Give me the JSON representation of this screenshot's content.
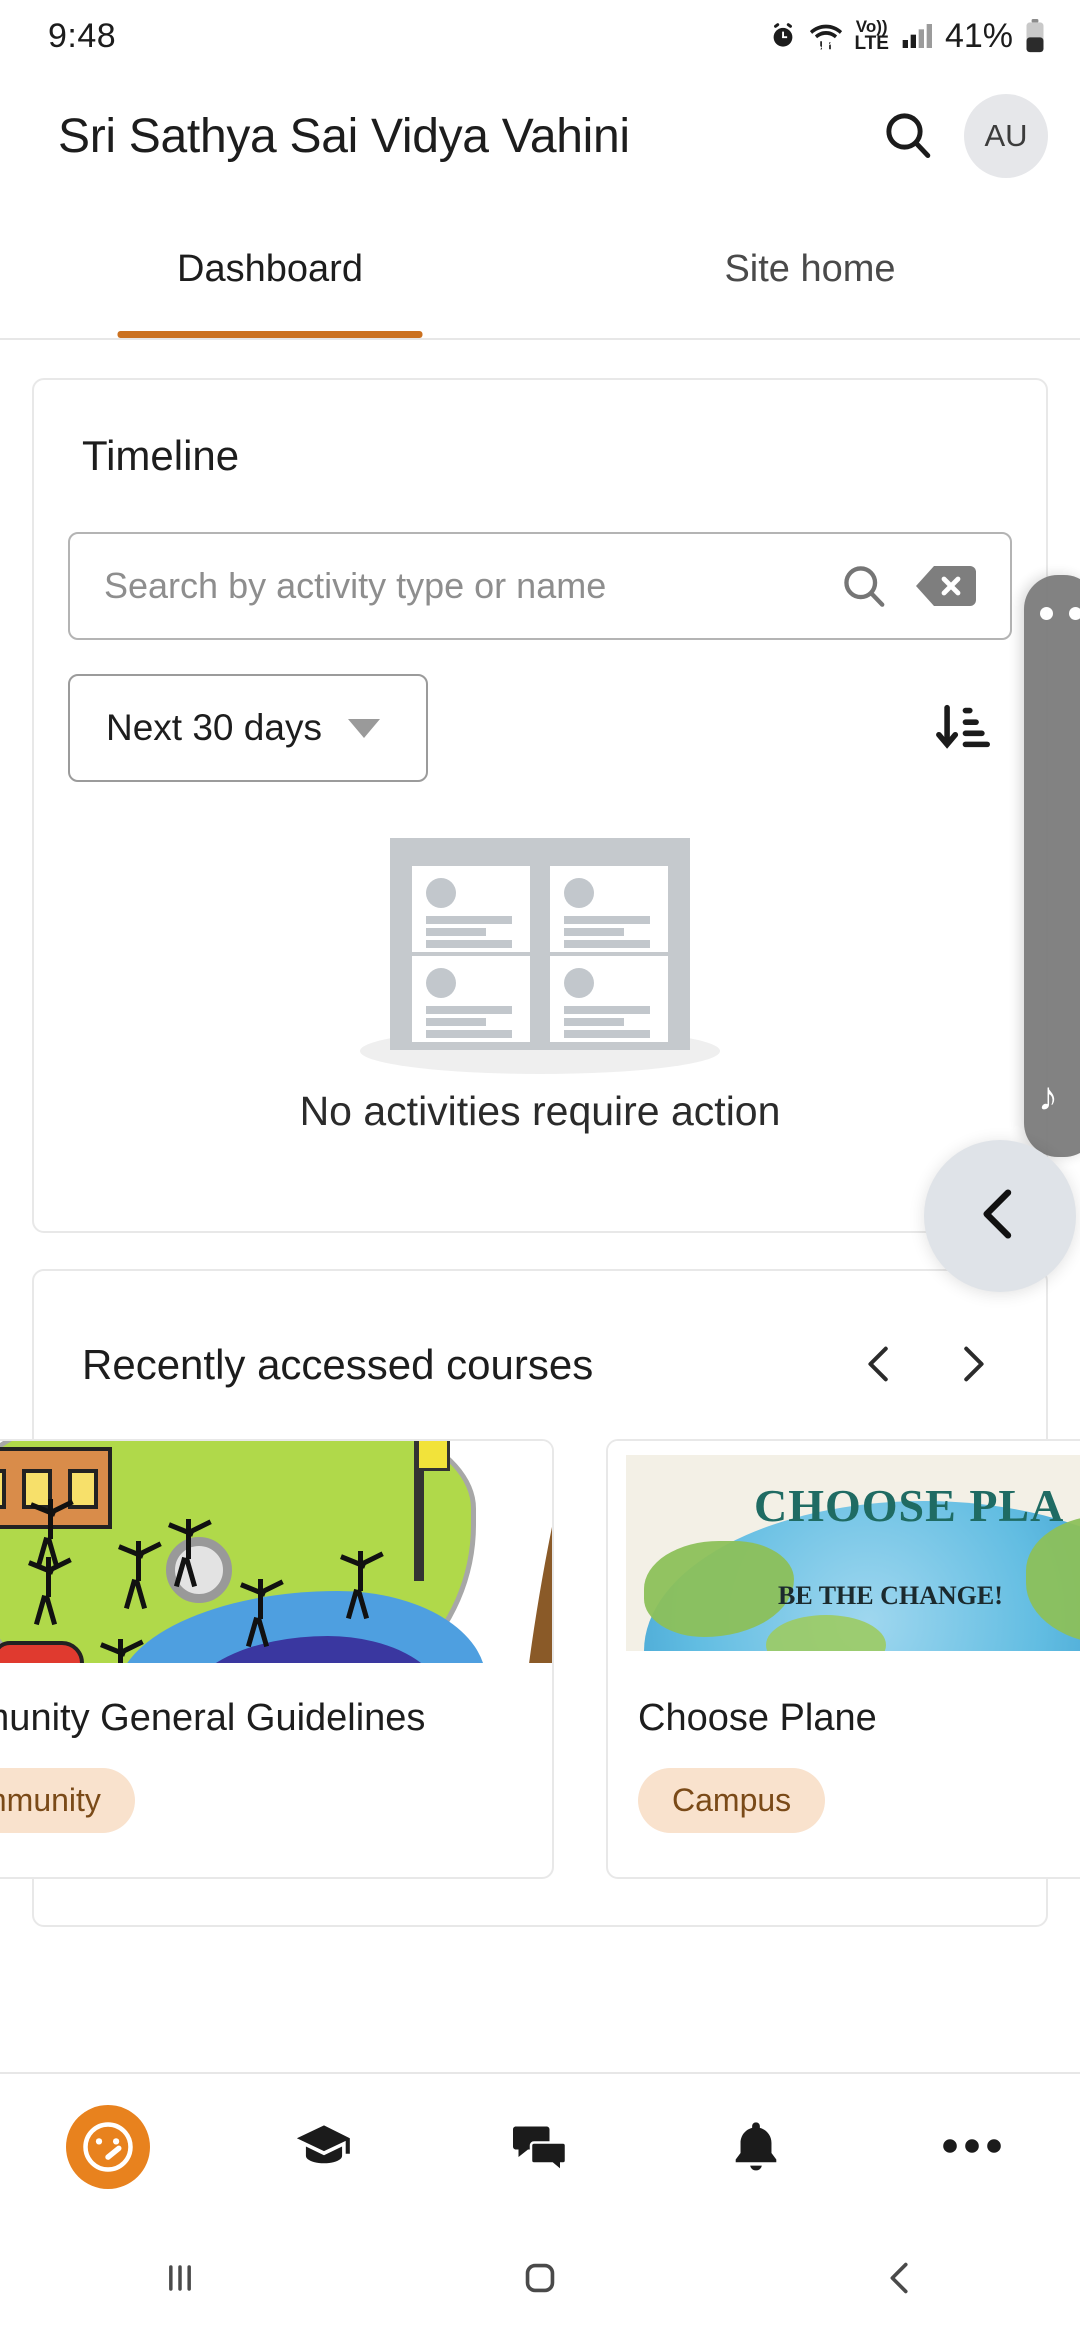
{
  "status_bar": {
    "time": "9:48",
    "battery_percent": "41%",
    "network_label": "LTE",
    "volte_label": "Vo))",
    "icons": [
      "alarm-icon",
      "wifi-icon",
      "volte-icon",
      "signal-icon",
      "battery-icon"
    ]
  },
  "app_bar": {
    "title": "Sri Sathya Sai Vidya Vahini",
    "search_icon": "search-icon",
    "avatar_initials": "AU"
  },
  "tabs": [
    {
      "label": "Dashboard",
      "active": true
    },
    {
      "label": "Site home",
      "active": false
    }
  ],
  "timeline": {
    "title": "Timeline",
    "search": {
      "placeholder": "Search by activity type or name",
      "value": "",
      "search_icon": "search-icon",
      "clear_icon": "backspace-clear-icon"
    },
    "date_filter": {
      "selected": "Next 30 days",
      "caret_icon": "chevron-down-icon"
    },
    "sort_icon": "sort-descending-icon",
    "empty_state": {
      "message": "No activities require action",
      "illustration": "empty-activities-board-illustration"
    }
  },
  "recently_accessed": {
    "title": "Recently accessed courses",
    "prev_icon": "chevron-left-icon",
    "next_icon": "chevron-right-icon",
    "courses": [
      {
        "name": "Community General Guidelines",
        "name_visible": "mmunity General Guidelines",
        "chip": "Community",
        "chip_visible": "mmunity",
        "image": "village-green-stick-figures-illustration"
      },
      {
        "name": "Choose Planet",
        "name_visible": "Choose Plane",
        "chip": "Campus",
        "chip_visible": "Campus",
        "image": "choose-planet-globe-poster",
        "poster_headline": "CHOOSE PLA",
        "poster_subline": "BE THE CHANGE!"
      }
    ]
  },
  "bottom_nav": [
    {
      "name": "dashboard",
      "icon": "dashboard-gauge-icon",
      "active": true
    },
    {
      "name": "courses",
      "icon": "graduation-cap-icon",
      "active": false
    },
    {
      "name": "messages",
      "icon": "chat-bubbles-icon",
      "active": false
    },
    {
      "name": "notifications",
      "icon": "bell-icon",
      "active": false
    },
    {
      "name": "more",
      "icon": "more-horizontal-icon",
      "active": false
    }
  ],
  "system_nav": [
    {
      "name": "recents",
      "icon": "recents-bars-icon"
    },
    {
      "name": "home",
      "icon": "home-square-icon"
    },
    {
      "name": "back",
      "icon": "back-chevron-icon"
    }
  ],
  "edge_panel": {
    "handle_icon": "music-note-icon",
    "collapse_icon": "chevron-left-icon"
  },
  "colors": {
    "accent": "#cb7120",
    "nav_active": "#e8821e",
    "chip_bg": "#f9e2cd",
    "chip_text": "#7a4a18",
    "card_border": "#e8e8e8"
  }
}
